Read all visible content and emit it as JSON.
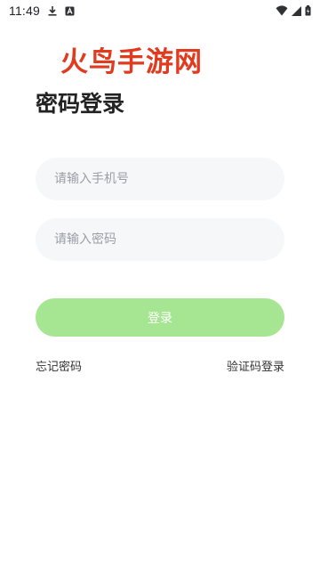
{
  "status_bar": {
    "time": "11:49",
    "left_icons": [
      "download-icon",
      "a-notification-icon"
    ],
    "right_icons": [
      "wifi-icon",
      "signal-icon",
      "battery-charging-icon"
    ]
  },
  "watermark": {
    "text": "火鸟手游网",
    "color": "#e23a1e"
  },
  "title": "密码登录",
  "form": {
    "phone_placeholder": "请输入手机号",
    "phone_value": "",
    "password_placeholder": "请输入密码",
    "password_value": "",
    "login_label": "登录",
    "login_color": "#a6e592"
  },
  "links": {
    "forgot_password": "忘记密码",
    "code_login": "验证码登录"
  }
}
